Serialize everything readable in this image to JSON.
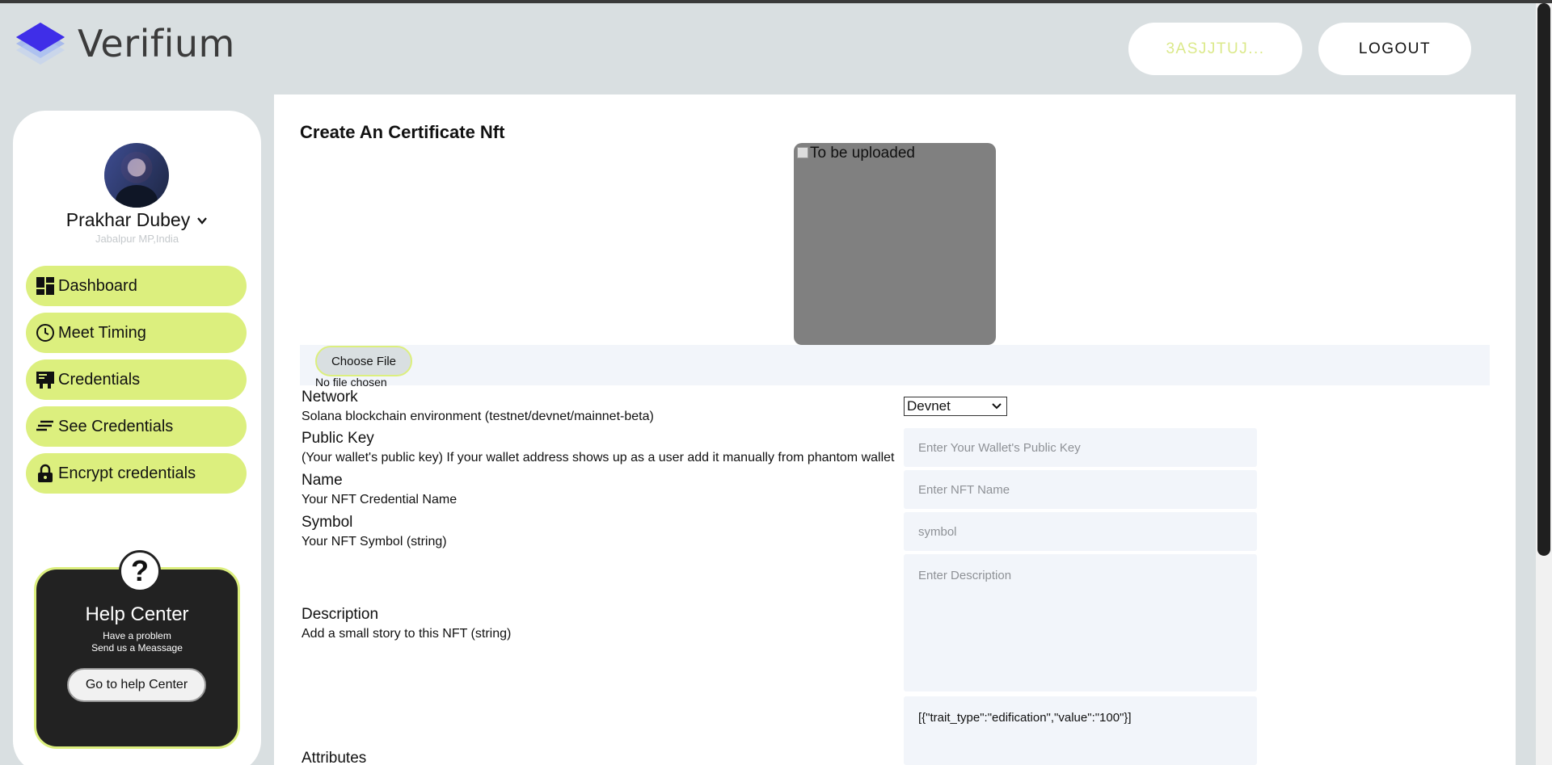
{
  "app": {
    "brand": "Verifium"
  },
  "header": {
    "wallet_label": "3ASJJTUJ...",
    "logout_label": "LOGOUT"
  },
  "user": {
    "name": "Prakhar Dubey",
    "location": "Jabalpur MP,India"
  },
  "sidebar": {
    "items": [
      {
        "label": "Dashboard",
        "icon": "dashboard-icon"
      },
      {
        "label": "Meet Timing",
        "icon": "clock-icon"
      },
      {
        "label": "Credentials",
        "icon": "certificate-icon"
      },
      {
        "label": "See Credentials",
        "icon": "list-icon"
      },
      {
        "label": "Encrypt credentials",
        "icon": "lock-icon"
      }
    ]
  },
  "help": {
    "title": "Help Center",
    "line1": "Have a problem",
    "line2": "Send us a Meassage",
    "button": "Go to help Center"
  },
  "form": {
    "title": "Create An Certificate Nft",
    "preview_alt": "To be uploaded",
    "choose_file": "Choose File",
    "no_file": "No file chosen",
    "network": {
      "label": "Network",
      "help": "Solana blockchain environment (testnet/devnet/mainnet-beta)",
      "selected": "Devnet"
    },
    "public_key": {
      "label": "Public Key",
      "help": "(Your wallet's public key) If your wallet address shows up as a user add it manually from phantom wallet",
      "placeholder": "Enter Your Wallet's Public Key"
    },
    "name": {
      "label": "Name",
      "help": "Your NFT Credential Name",
      "placeholder": "Enter NFT Name"
    },
    "symbol": {
      "label": "Symbol",
      "help": "Your NFT Symbol (string)",
      "placeholder": "symbol"
    },
    "description": {
      "label": "Description",
      "help": "Add a small story to this NFT (string)",
      "placeholder": "Enter Description"
    },
    "attributes": {
      "label": "Attributes",
      "value": "[{\"trait_type\":\"edification\",\"value\":\"100\"}]"
    }
  },
  "colors": {
    "accent": "#dcef7e",
    "background": "#d9dfe1",
    "brand_blue": "#3b3bf5"
  }
}
